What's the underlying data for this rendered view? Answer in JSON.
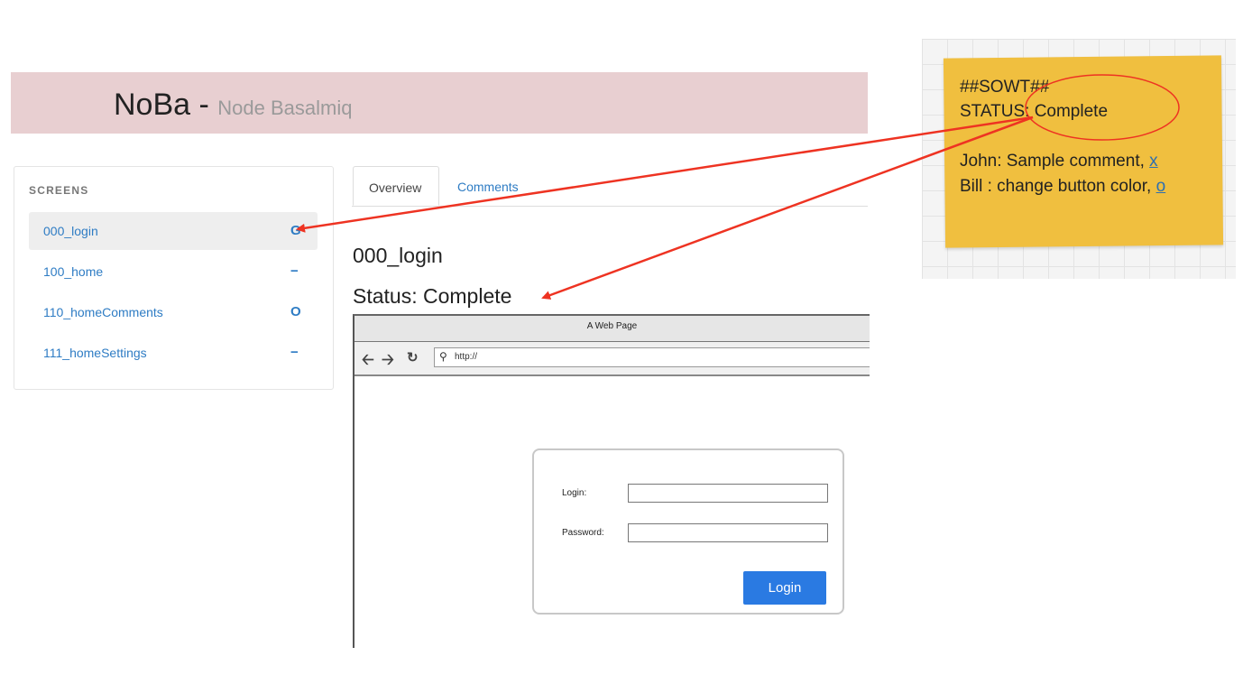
{
  "header": {
    "brand": "NoBa -",
    "subtitle": "Node Basalmiq"
  },
  "sidebar": {
    "title": "SCREENS",
    "items": [
      {
        "label": "000_login",
        "icon": "G",
        "active": true
      },
      {
        "label": "100_home",
        "icon": "−"
      },
      {
        "label": "110_homeComments",
        "icon": "O"
      },
      {
        "label": "111_homeSettings",
        "icon": "−"
      }
    ]
  },
  "tabs": [
    {
      "label": "Overview",
      "active": true
    },
    {
      "label": "Comments"
    }
  ],
  "main": {
    "screen_title": "000_login",
    "status": "Status: Complete"
  },
  "mockup": {
    "browser_title": "A Web Page",
    "url": "http://",
    "login_label": "Login:",
    "password_label": "Password:",
    "login_button": "Login"
  },
  "note": {
    "line1": "##SOWT##",
    "line2": "STATUS: Complete",
    "line3_text": "John: Sample comment,",
    "line3_link": "x",
    "line4_text": "Bill : change button color,",
    "line4_link": "o"
  },
  "colors": {
    "accent": "#2e7cc4",
    "header_bg": "#e8cfd1",
    "note_bg": "#f0bf3f",
    "button": "#2a7ae2",
    "arrow": "#ee3322"
  }
}
